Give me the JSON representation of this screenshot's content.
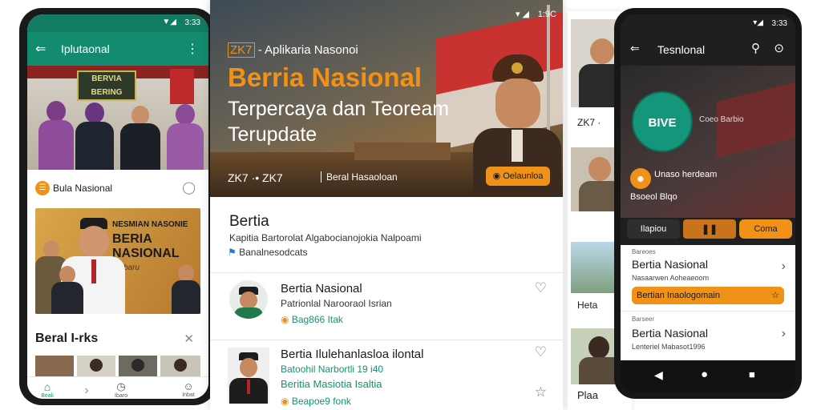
{
  "colors": {
    "green": "#138b6f",
    "orange": "#f09217",
    "dark": "#1f1f1f",
    "text_green": "#139473"
  },
  "left_phone": {
    "status_time": "3:33",
    "app_title": "Iplutaonal",
    "menu_icon": "back-arrow-icon",
    "hero_sign_lines": [
      "BERVIA",
      "BERING"
    ],
    "news_row_label": "Bula Nasional",
    "card_title_lines": [
      "NESMIAN NASONIE",
      "BERIA",
      "NASIONAL",
      "Terbaru"
    ],
    "section_title": "Beral I-rks",
    "nav_items": [
      "Beali",
      "",
      "Ibaro",
      "Inbat"
    ]
  },
  "middle": {
    "status_time": "1:9C",
    "hero_brand": "ZK7",
    "hero_subtitle": "- Aplikaria Nasonoi",
    "hero_title": "Berria Nasional",
    "hero_tagline_1": "Terpercaya dan Teoream",
    "hero_tagline_2": "Terupdate",
    "hero_strip_left": "ZK7 ·• ZK7",
    "hero_strip_right": "Beral Hasaoloan",
    "hero_button": "Oelaunloa",
    "section_title": "Bertia",
    "section_subtitle": "Kapitia Bartorolat Algabocianojokia Nalpoami",
    "section_link": "Banalnesodcats",
    "articles": [
      {
        "title": "Bertia Nasional",
        "meta": "Patrionlal Narooraol Isrian",
        "tag": "Bag866 Itak"
      },
      {
        "title": "Bertia Ilulehanlasloa ilontal",
        "meta": "Batoohil Narbortli 19 i40",
        "sub": "Beritia Masiotia Isaltia",
        "tag": "Beapoe9 fonk"
      }
    ]
  },
  "right_column": {
    "labels": [
      "ZK7 ·",
      "Heta",
      "Plaa"
    ]
  },
  "right_phone": {
    "status_time": "3:33",
    "app_title": "Tesnlonal",
    "badge_text": "BIVE",
    "header_label": "Coeo Barbio",
    "profile_name": "Unaso herdeam",
    "profile_sub": "Bsoeol Blqo",
    "tabs": [
      "Ilapiou",
      "",
      "Coma"
    ],
    "items": [
      {
        "overline": "Bareoes",
        "title": "Bertia Nasional",
        "sub": "Nasaarwen Aoheaeoom",
        "bar": "Bertian Inaologomain"
      },
      {
        "overline": "Barseer",
        "title": "Bertia Nasional",
        "sub": "Lenteriel Mabasot1996"
      }
    ]
  }
}
